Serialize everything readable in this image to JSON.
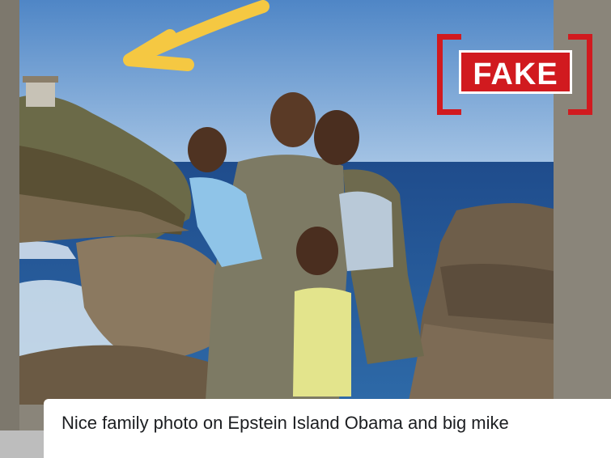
{
  "stamp": {
    "label": "FAKE",
    "color": "#d11a1f"
  },
  "arrow": {
    "color": "#f5c842",
    "icon": "yellow-arrow-icon"
  },
  "post": {
    "caption": "Nice family photo on Epstein Island Obama and big mike"
  }
}
